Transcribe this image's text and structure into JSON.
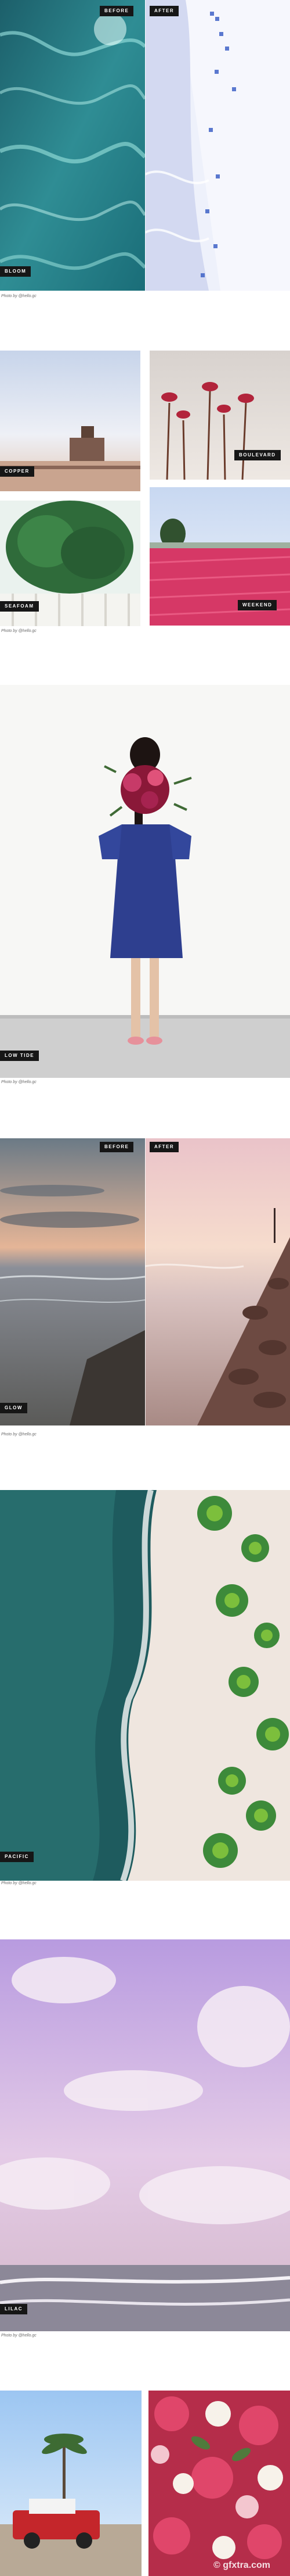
{
  "labels": {
    "before": "BEFORE",
    "after": "AFTER"
  },
  "sections": {
    "bloom": {
      "preset": "BLOOM",
      "credit": "Photo by @hello.gc"
    },
    "quad": {
      "copper": "COPPER",
      "boulevard": "BOULEVARD",
      "seafoam": "SEAFOAM",
      "weekend": "WEEKEND",
      "credit": "Photo by @hello.gc"
    },
    "lowtide": {
      "preset": "LOW TIDE",
      "credit": "Photo by @hello.gc"
    },
    "glow": {
      "preset": "GLOW",
      "credit": "Photo by @hello.gc"
    },
    "pacific": {
      "preset": "PACIFIC",
      "credit": "Photo by @hello.gc"
    },
    "lilac": {
      "preset": "LILAC",
      "credit": "Photo by @hello.gc"
    }
  },
  "watermark": "© gfxtra.com",
  "colors": {
    "tag_bg": "#161616",
    "tag_text": "#ffffff"
  }
}
